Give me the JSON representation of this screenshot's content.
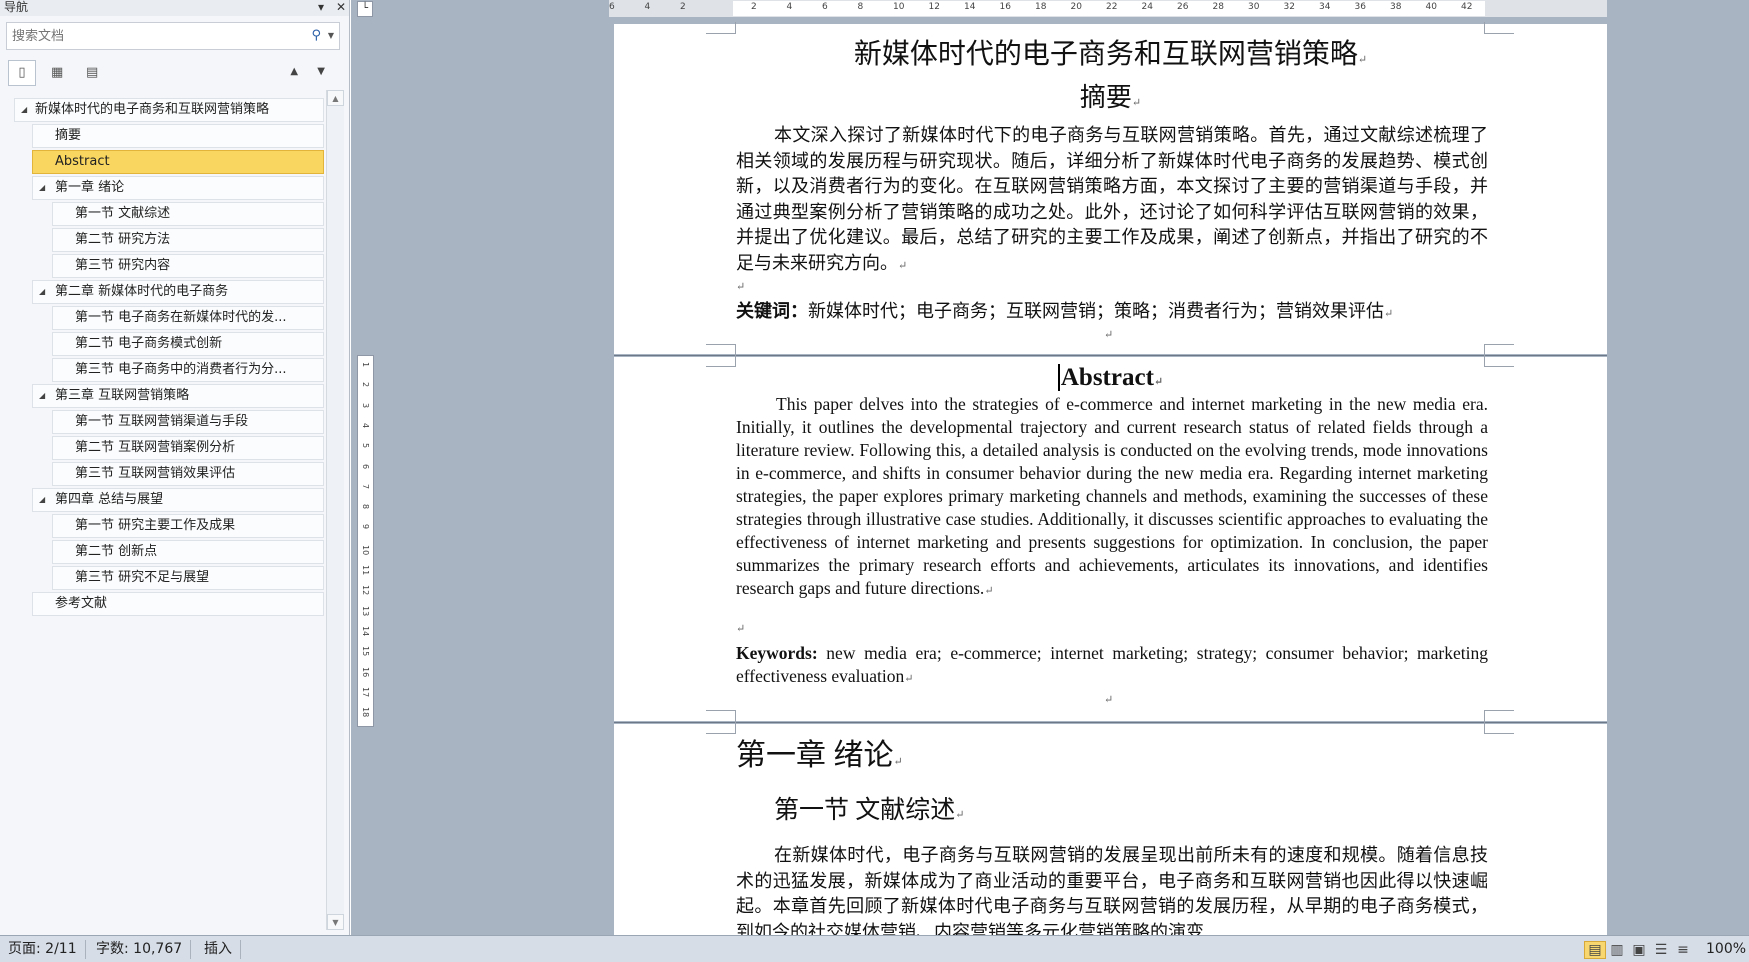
{
  "nav": {
    "title": "导航",
    "search_placeholder": "搜索文档",
    "tree": [
      {
        "label": "新媒体时代的电子商务和互联网营销策略",
        "level": 1,
        "expandable": true
      },
      {
        "label": "摘要",
        "level": 2
      },
      {
        "label": "Abstract",
        "level": 2,
        "selected": true
      },
      {
        "label": "第一章 绪论",
        "level": 2,
        "expandable": true
      },
      {
        "label": "第一节 文献综述",
        "level": 3
      },
      {
        "label": "第二节 研究方法",
        "level": 3
      },
      {
        "label": "第三节 研究内容",
        "level": 3
      },
      {
        "label": "第二章 新媒体时代的电子商务",
        "level": 2,
        "expandable": true
      },
      {
        "label": "第一节 电子商务在新媒体时代的发...",
        "level": 3
      },
      {
        "label": "第二节 电子商务模式创新",
        "level": 3
      },
      {
        "label": "第三节 电子商务中的消费者行为分...",
        "level": 3
      },
      {
        "label": "第三章 互联网营销策略",
        "level": 2,
        "expandable": true
      },
      {
        "label": "第一节 互联网营销渠道与手段",
        "level": 3
      },
      {
        "label": "第二节 互联网营销案例分析",
        "level": 3
      },
      {
        "label": "第三节 互联网营销效果评估",
        "level": 3
      },
      {
        "label": "第四章 总结与展望",
        "level": 2,
        "expandable": true
      },
      {
        "label": "第一节 研究主要工作及成果",
        "level": 3
      },
      {
        "label": "第二节 创新点",
        "level": 3
      },
      {
        "label": "第三节 研究不足与展望",
        "level": 3
      },
      {
        "label": "参考文献",
        "level": 2
      }
    ]
  },
  "ruler": {
    "h_labels": [
      "6",
      "4",
      "2",
      "",
      "2",
      "4",
      "6",
      "8",
      "10",
      "12",
      "14",
      "16",
      "18",
      "20",
      "22",
      "24",
      "26",
      "28",
      "30",
      "32",
      "34",
      "36",
      "38",
      "40",
      "42"
    ],
    "v_labels": [
      "1",
      "2",
      "3",
      "4",
      "5",
      "6",
      "7",
      "8",
      "9",
      "10",
      "11",
      "12",
      "13",
      "14",
      "15",
      "16",
      "17",
      "18"
    ]
  },
  "doc": {
    "title": "新媒体时代的电子商务和互联网营销策略",
    "abstract_zh_heading": "摘要",
    "abstract_zh_body": "本文深入探讨了新媒体时代下的电子商务与互联网营销策略。首先，通过文献综述梳理了相关领域的发展历程与研究现状。随后，详细分析了新媒体时代电子商务的发展趋势、模式创新，以及消费者行为的变化。在互联网营销策略方面，本文探讨了主要的营销渠道与手段，并通过典型案例分析了营销策略的成功之处。此外，还讨论了如何科学评估互联网营销的效果，并提出了优化建议。最后，总结了研究的主要工作及成果，阐述了创新点，并指出了研究的不足与未来研究方向。",
    "keywords_zh_label": "关键词：",
    "keywords_zh": "新媒体时代；电子商务；互联网营销；策略；消费者行为；营销效果评估",
    "abstract_en_heading": "Abstract",
    "abstract_en_body": "This paper delves into the strategies of e-commerce and internet marketing in the new media era. Initially, it outlines the developmental trajectory and current research status of related fields through a literature review. Following this, a detailed analysis is conducted on the evolving trends, mode innovations in e-commerce, and shifts in consumer behavior during the new media era. Regarding internet marketing strategies, the paper explores primary marketing channels and methods, examining the successes of these strategies through illustrative case studies. Additionally, it discusses scientific approaches to evaluating the effectiveness of internet marketing and presents suggestions for optimization. In conclusion, the paper summarizes the primary research efforts and achievements, articulates its innovations, and identifies research gaps and future directions.",
    "keywords_en_label": "Keywords:",
    "keywords_en": "new media era; e-commerce; internet marketing; strategy; consumer behavior; marketing effectiveness evaluation",
    "chapter1_heading": "第一章 绪论",
    "section1_heading": "第一节 文献综述",
    "section1_body": "在新媒体时代，电子商务与互联网营销的发展呈现出前所未有的速度和规模。随着信息技术的迅猛发展，新媒体成为了商业活动的重要平台，电子商务和互联网营销也因此得以快速崛起。本章首先回顾了新媒体时代电子商务与互联网营销的发展历程，从早期的电子商务模式，到如今的社交媒体营销、内容营销等多元化营销策略的演变"
  },
  "status": {
    "page": "页面: 2/11",
    "words": "字数: 10,767",
    "mode": "插入",
    "zoom": "100%"
  }
}
